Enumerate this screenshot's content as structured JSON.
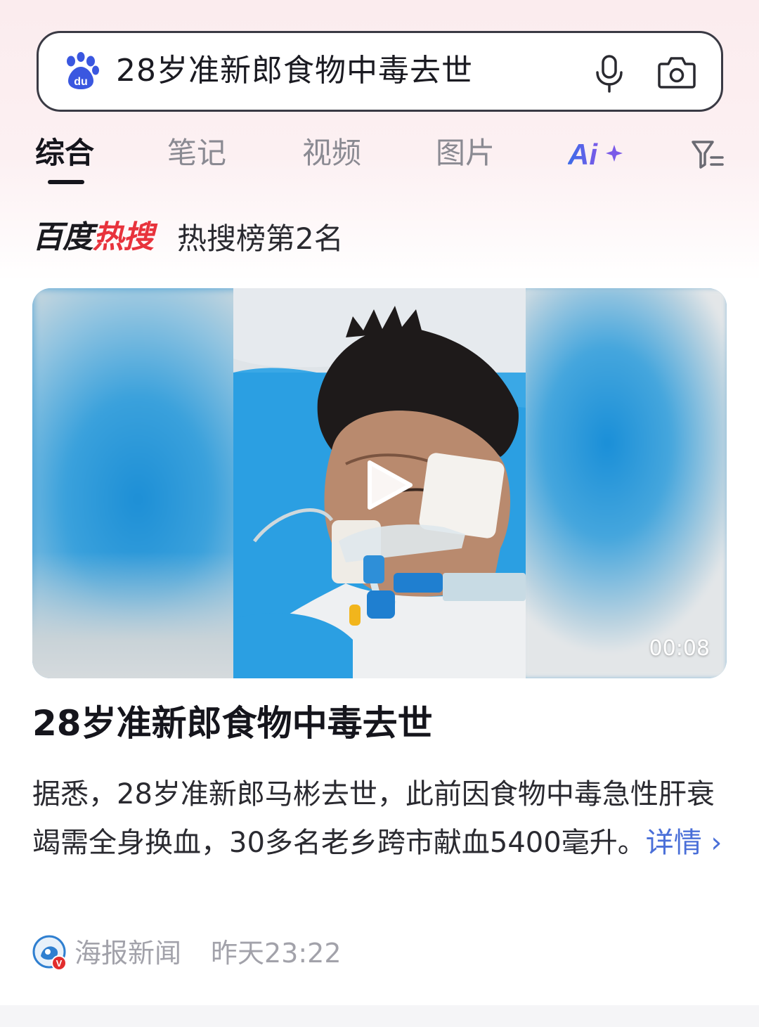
{
  "search": {
    "query": "28岁准新郎食物中毒去世",
    "logo_icon": "baidu-paw-icon",
    "voice_icon": "microphone-icon",
    "camera_icon": "camera-icon"
  },
  "tabs": [
    {
      "label": "综合",
      "active": true
    },
    {
      "label": "笔记",
      "active": false
    },
    {
      "label": "视频",
      "active": false
    },
    {
      "label": "图片",
      "active": false
    }
  ],
  "ai_tab": {
    "label": "Ai",
    "icon": "sparkle-icon"
  },
  "filter_icon": "filter-icon",
  "hot_search": {
    "logo_black": "百度",
    "logo_red": "热搜",
    "rank_text": "热搜榜第2名"
  },
  "video": {
    "duration": "00:08",
    "play_icon": "play-icon"
  },
  "article": {
    "title": "28岁准新郎食物中毒去世",
    "summary": "据悉，28岁准新郎马彬去世，此前因食物中毒急性肝衰竭需全身换血，30多名老乡跨市献血5400毫升。",
    "detail_link": "详情",
    "source": "海报新闻",
    "time": "昨天23:22"
  },
  "colors": {
    "accent_blue": "#4a6fd8",
    "hot_red": "#e8333c",
    "baidu_blue": "#3a57e0"
  }
}
